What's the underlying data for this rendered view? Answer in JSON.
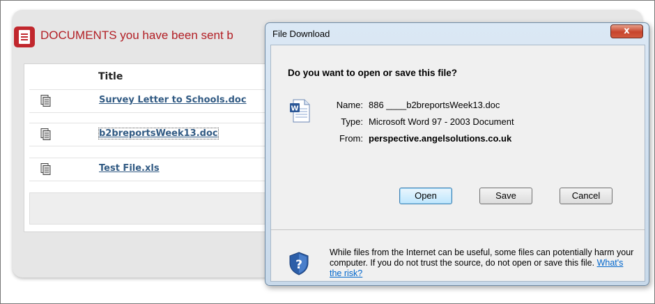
{
  "page": {
    "heading": "DOCUMENTS you have been sent b",
    "list_header": "Title",
    "documents": [
      {
        "name": "Survey Letter to Schools.doc",
        "icon": "document-icon"
      },
      {
        "name": "b2breportsWeek13.doc",
        "icon": "document-icon"
      },
      {
        "name": "Test File.xls",
        "icon": "document-icon"
      }
    ]
  },
  "dialog": {
    "title": "File Download",
    "close_label": "x",
    "question": "Do you want to open or save this file?",
    "labels": {
      "name": "Name:",
      "type": "Type:",
      "from": "From:"
    },
    "values": {
      "name": "886 ____b2breportsWeek13.doc",
      "type": "Microsoft Word 97 - 2003 Document",
      "from": "perspective.angelsolutions.co.uk"
    },
    "buttons": {
      "open": "Open",
      "save": "Save",
      "cancel": "Cancel"
    },
    "warning": "While files from the Internet can be useful, some files can potentially harm your computer. If you do not trust the source, do not open or save this file.",
    "warning_link": "What's the risk?"
  },
  "colors": {
    "accent": "#c1272d",
    "link": "#315a83",
    "dialog_link": "#0066cc"
  }
}
